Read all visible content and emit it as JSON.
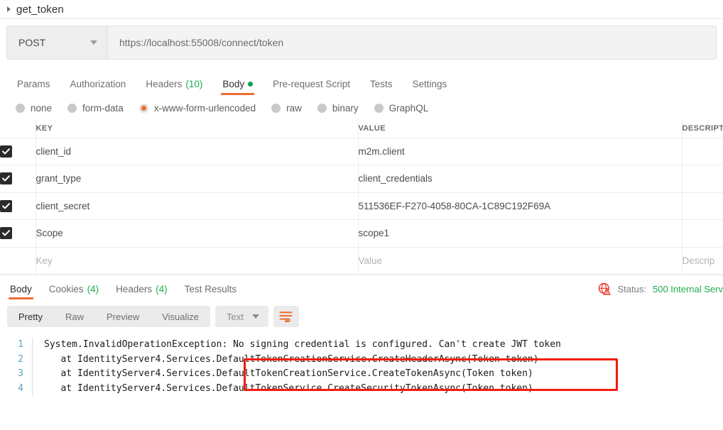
{
  "request": {
    "name": "get_token",
    "expand_icon": "caret-right-icon",
    "method": "POST",
    "method_dropdown_icon": "chevron-down-icon",
    "url": "https://localhost:55008/connect/token",
    "tabs": [
      {
        "label": "Params",
        "count": "",
        "active": false,
        "dot": false
      },
      {
        "label": "Authorization",
        "count": "",
        "active": false,
        "dot": false
      },
      {
        "label": "Headers",
        "count": "(10)",
        "active": false,
        "dot": false
      },
      {
        "label": "Body",
        "count": "",
        "active": true,
        "dot": true
      },
      {
        "label": "Pre-request Script",
        "count": "",
        "active": false,
        "dot": false
      },
      {
        "label": "Tests",
        "count": "",
        "active": false,
        "dot": false
      },
      {
        "label": "Settings",
        "count": "",
        "active": false,
        "dot": false
      }
    ],
    "body_types": [
      {
        "label": "none",
        "selected": false
      },
      {
        "label": "form-data",
        "selected": false
      },
      {
        "label": "x-www-form-urlencoded",
        "selected": true
      },
      {
        "label": "raw",
        "selected": false
      },
      {
        "label": "binary",
        "selected": false
      },
      {
        "label": "GraphQL",
        "selected": false
      }
    ],
    "table": {
      "headers": [
        "KEY",
        "VALUE",
        "DESCRIPTION"
      ],
      "rows": [
        {
          "checked": true,
          "key": "client_id",
          "value": "m2m.client",
          "description": ""
        },
        {
          "checked": true,
          "key": "grant_type",
          "value": "client_credentials",
          "description": ""
        },
        {
          "checked": true,
          "key": "client_secret",
          "value": "511536EF-F270-4058-80CA-1C89C192F69A",
          "description": ""
        },
        {
          "checked": true,
          "key": "Scope",
          "value": "scope1",
          "description": ""
        }
      ],
      "new_row": {
        "key_placeholder": "Key",
        "value_placeholder": "Value",
        "description_placeholder": "Descrip"
      }
    }
  },
  "response": {
    "tabs": [
      {
        "label": "Body",
        "count": "",
        "active": true
      },
      {
        "label": "Cookies",
        "count": "(4)",
        "active": false
      },
      {
        "label": "Headers",
        "count": "(4)",
        "active": false
      },
      {
        "label": "Test Results",
        "count": "",
        "active": false
      }
    ],
    "warning_icon": "globe-warning-icon",
    "status_label": "Status:",
    "status_value": "500 Internal Serv",
    "view_modes": [
      {
        "label": "Pretty",
        "active": true
      },
      {
        "label": "Raw",
        "active": false
      },
      {
        "label": "Preview",
        "active": false
      },
      {
        "label": "Visualize",
        "active": false
      }
    ],
    "format": "Text",
    "format_caret_icon": "chevron-down-icon",
    "wrap_icon": "word-wrap-icon",
    "code_lines": [
      {
        "number": "1",
        "text": "System.InvalidOperationException: No signing credential is configured. Can't create JWT token"
      },
      {
        "number": "2",
        "text": "   at IdentityServer4.Services.DefaultTokenCreationService.CreateHeaderAsync(Token token)"
      },
      {
        "number": "3",
        "text": "   at IdentityServer4.Services.DefaultTokenCreationService.CreateTokenAsync(Token token)"
      },
      {
        "number": "4",
        "text": "   at IdentityServer4.Services.DefaultTokenService.CreateSecurityTokenAsync(Token token)"
      }
    ],
    "annotation": {
      "name": "error-message-highlight",
      "color": "#f51b0e"
    }
  },
  "colors": {
    "accent": "#ef6c33",
    "success": "#1eab4b",
    "error": "#f51b0e",
    "line_number": "#61a0c4"
  }
}
